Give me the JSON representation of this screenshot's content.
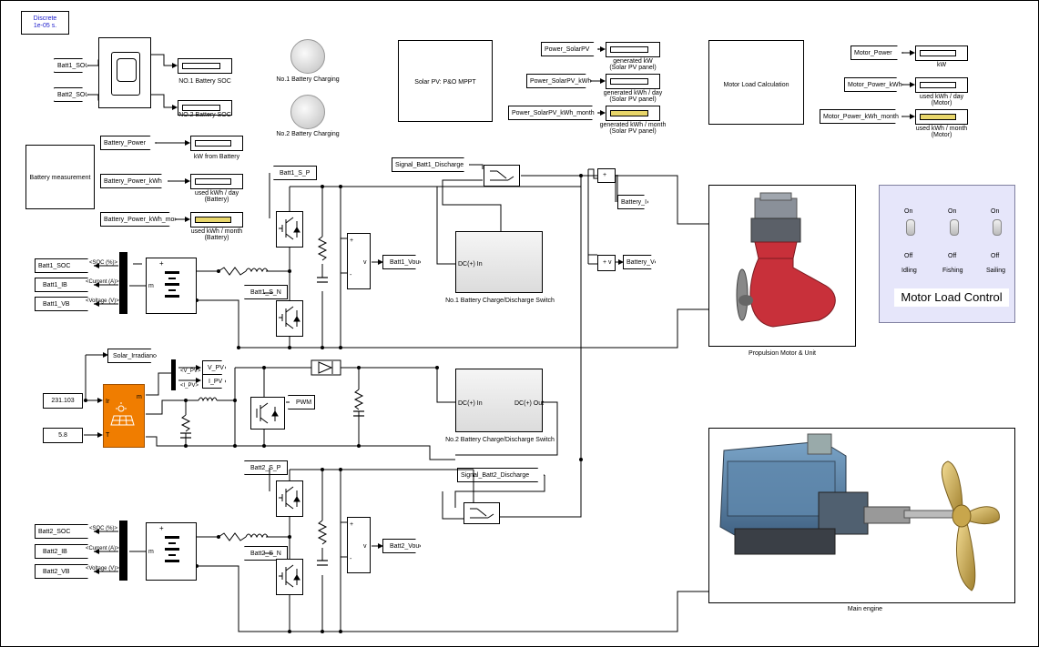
{
  "solver": {
    "line1": "Discrete",
    "line2": "1e-05 s."
  },
  "soc_scope": {
    "in1": "Batt1_SOC",
    "in2": "Batt2_SOC",
    "disp1": "NO.1 Battery SOC",
    "disp2": "NO.2 Battery SOC"
  },
  "lamps": {
    "lamp1": "No.1 Battery Charging",
    "lamp2": "No.2 Battery Charging"
  },
  "solar_mppt": "Solar PV: P&O MPPT",
  "solar_power": [
    {
      "tag": "Power_SolarPV",
      "line1": "generated kW",
      "line2": "(Solar PV panel)",
      "yellow": false
    },
    {
      "tag": "Power_SolarPV_kWh",
      "line1": "generated kWh / day",
      "line2": "(Solar PV panel)",
      "yellow": false
    },
    {
      "tag": "Power_SolarPV_kWh_month",
      "line1": "generated kWh / month",
      "line2": "(Solar PV panel)",
      "yellow": true
    }
  ],
  "motor_calc": "Motor Load Calculation",
  "motor_power": [
    {
      "tag": "Motor_Power",
      "line1": "kW",
      "line2": "",
      "yellow": false
    },
    {
      "tag": "Motor_Power_kWh",
      "line1": "used kWh / day",
      "line2": "(Motor)",
      "yellow": false
    },
    {
      "tag": "Motor_Power_kWh_month",
      "line1": "used kWh / month",
      "line2": "(Motor)",
      "yellow": true
    }
  ],
  "battery_measure": "Battery measurement",
  "battery_power": [
    {
      "tag": "Battery_Power",
      "line1": "kW from Battery",
      "line2": "",
      "yellow": false
    },
    {
      "tag": "Battery_Power_kWh",
      "line1": "used kWh / day",
      "line2": "(Battery)",
      "yellow": false
    },
    {
      "tag": "Battery_Power_kWh_month",
      "line1": "used kWh / month",
      "line2": "(Battery)",
      "yellow": true
    }
  ],
  "batt1": {
    "out_soc": "Batt1_SOC",
    "out_ib": "Batt1_IB",
    "out_vb": "Batt1_VB",
    "sig_soc": "<SOC (%)>",
    "sig_cur": "<Current (A)>",
    "sig_volt": "<Voltage (V)>",
    "sp": "Batt1_S_P",
    "sn": "Batt1_S_N",
    "vout": "Batt1_Vout",
    "m": "m"
  },
  "batt2": {
    "out_soc": "Batt2_SOC",
    "out_ib": "Batt2_IB",
    "out_vb": "Batt2_VB",
    "sig_soc": "<SOC (%)>",
    "sig_cur": "<Current (A)>",
    "sig_volt": "<Voltage (V)>",
    "sp": "Batt2_S_P",
    "sn": "Batt2_S_N",
    "vout": "Batt2_Vout",
    "m": "m"
  },
  "signals": {
    "batt1_discharge": "Signal_Batt1_Discharge",
    "batt2_discharge": "Signal_Batt2_Discharge",
    "battery_i": "Battery_I",
    "battery_v": "Battery_V"
  },
  "switch1": {
    "label": "No.1 Battery Charge/Discharge Switch",
    "in": "DC(+) In",
    "out": "DC(+) Out"
  },
  "switch2": {
    "label": "No.2 Battery Charge/Discharge Switch",
    "in": "DC(+) In",
    "out": "DC(+) Out"
  },
  "pv": {
    "irr": "Solar_Irradiance",
    "const1": "231.103",
    "const2": "5.8",
    "vpv_sig": "<V_PV>",
    "ipv_sig": "<I_PV>",
    "vpv": "V_PV",
    "ipv": "I_PV",
    "pwm": "PWM",
    "port_ir": "Ir",
    "port_t": "T",
    "port_m": "m"
  },
  "propulsion": {
    "label": "Propulsion Motor & Unit"
  },
  "motor_control": {
    "title": "Motor Load Control",
    "on": "On",
    "off": "Off",
    "modes": [
      "Idling",
      "Fishing",
      "Sailing"
    ]
  },
  "engine": {
    "label": "Main engine"
  },
  "colors": {
    "pv_orange": "#f07d00",
    "panel_bg": "#e6e6fa",
    "yellow": "#e8d66a",
    "hull_red": "#c8303a"
  }
}
